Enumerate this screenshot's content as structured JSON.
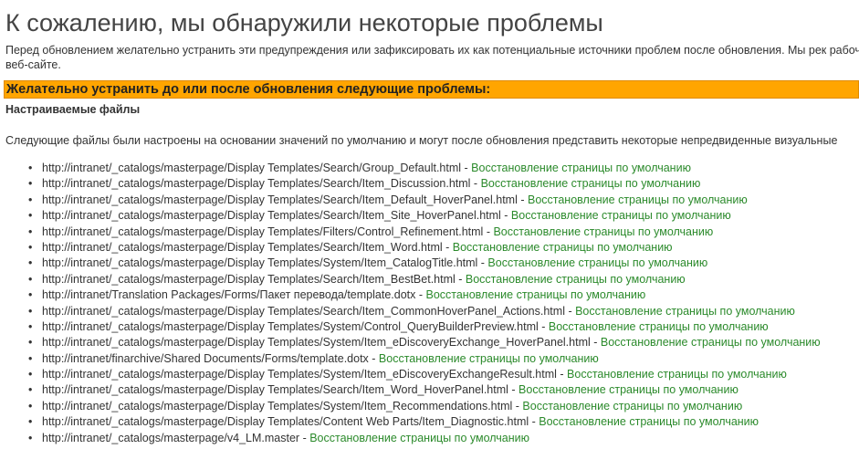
{
  "page": {
    "title": "К сожалению, мы обнаружили некоторые проблемы",
    "intro": "Перед обновлением желательно устранить эти предупреждения или зафиксировать их как потенциальные источники проблем после обновления. Мы рек рабочем веб-сайте."
  },
  "warning": {
    "title": "Желательно устранить до или после обновления следующие проблемы:",
    "color": "#ffa500"
  },
  "section": {
    "title": "Настраиваемые файлы",
    "description": "Следующие файлы были настроены на основании значений по умолчанию и могут после обновления представить некоторые непредвиденные визуальные"
  },
  "files": {
    "separator": " - ",
    "link_color": "#2b8a2b",
    "items": [
      {
        "path": "http://intranet/_catalogs/masterpage/Display Templates/Search/Group_Default.html",
        "link": "Восстановление страницы по умолчанию"
      },
      {
        "path": "http://intranet/_catalogs/masterpage/Display Templates/Search/Item_Discussion.html",
        "link": "Восстановление страницы по умолчанию"
      },
      {
        "path": "http://intranet/_catalogs/masterpage/Display Templates/Search/Item_Default_HoverPanel.html",
        "link": "Восстановление страницы по умолчанию"
      },
      {
        "path": "http://intranet/_catalogs/masterpage/Display Templates/Search/Item_Site_HoverPanel.html",
        "link": "Восстановление страницы по умолчанию"
      },
      {
        "path": "http://intranet/_catalogs/masterpage/Display Templates/Filters/Control_Refinement.html",
        "link": "Восстановление страницы по умолчанию"
      },
      {
        "path": "http://intranet/_catalogs/masterpage/Display Templates/Search/Item_Word.html",
        "link": "Восстановление страницы по умолчанию"
      },
      {
        "path": "http://intranet/_catalogs/masterpage/Display Templates/System/Item_CatalogTitle.html",
        "link": "Восстановление страницы по умолчанию"
      },
      {
        "path": "http://intranet/_catalogs/masterpage/Display Templates/Search/Item_BestBet.html",
        "link": "Восстановление страницы по умолчанию"
      },
      {
        "path": "http://intranet/Translation Packages/Forms/Пакет перевода/template.dotx",
        "link": "Восстановление страницы по умолчанию"
      },
      {
        "path": "http://intranet/_catalogs/masterpage/Display Templates/Search/Item_CommonHoverPanel_Actions.html",
        "link": "Восстановление страницы по умолчанию"
      },
      {
        "path": "http://intranet/_catalogs/masterpage/Display Templates/System/Control_QueryBuilderPreview.html",
        "link": "Восстановление страницы по умолчанию"
      },
      {
        "path": "http://intranet/_catalogs/masterpage/Display Templates/System/Item_eDiscoveryExchange_HoverPanel.html",
        "link": "Восстановление страницы по умолчанию"
      },
      {
        "path": "http://intranet/finarchive/Shared Documents/Forms/template.dotx",
        "link": "Восстановление страницы по умолчанию"
      },
      {
        "path": "http://intranet/_catalogs/masterpage/Display Templates/System/Item_eDiscoveryExchangeResult.html",
        "link": "Восстановление страницы по умолчанию"
      },
      {
        "path": "http://intranet/_catalogs/masterpage/Display Templates/Search/Item_Word_HoverPanel.html",
        "link": "Восстановление страницы по умолчанию"
      },
      {
        "path": "http://intranet/_catalogs/masterpage/Display Templates/System/Item_Recommendations.html",
        "link": "Восстановление страницы по умолчанию"
      },
      {
        "path": "http://intranet/_catalogs/masterpage/Display Templates/Content Web Parts/Item_Diagnostic.html",
        "link": "Восстановление страницы по умолчанию"
      },
      {
        "path": "http://intranet/_catalogs/masterpage/v4_LM.master",
        "link": "Восстановление страницы по умолчанию"
      }
    ]
  }
}
